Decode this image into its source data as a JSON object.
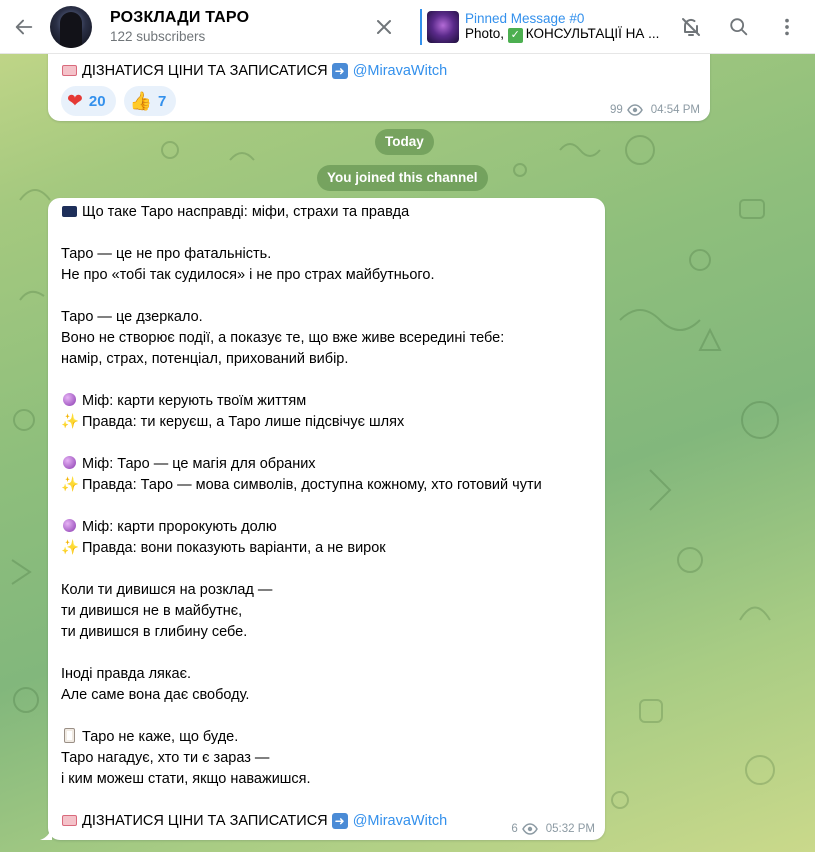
{
  "header": {
    "title": "РОЗКЛАДИ ТАРО",
    "subscribers": "122 subscribers",
    "pinned_title": "Pinned Message #0",
    "pinned_prefix": "Photo, ",
    "pinned_text": "КОНСУЛЬТАЦІЇ НА ..."
  },
  "prev_message": {
    "cta_text": "ДІЗНАТИСЯ ЦІНИ ТА ЗАПИСАТИСЯ",
    "handle": "@MiravaWitch",
    "reactions": [
      {
        "emoji": "heart-icon",
        "count": "20"
      },
      {
        "emoji": "thumbs-up-icon",
        "count": "7"
      }
    ],
    "views": "99",
    "time": "04:54 PM"
  },
  "service": {
    "date_label": "Today",
    "joined_label": "You joined this channel"
  },
  "message": {
    "lines": [
      "Що таке Таро насправді: міфи, страхи та правда",
      "Таро — це не про фатальність.",
      "Не про «тобі так судилося» і не про страх майбутнього.",
      "Таро — це дзеркало.",
      "Воно не створює події, а показує те, що вже живе всередині тебе:",
      "намір, страх, потенціал, прихований вибір.",
      "Міф: карти керують твоїм життям",
      "Правда: ти керуєш, а Таро лише підсвічує шлях",
      "Міф: Таро — це магія для обраних",
      "Правда: Таро — мова символів, доступна кожному, хто готовий чути",
      "Міф: карти пророкують долю",
      "Правда: вони показують варіанти, а не вирок",
      "Коли ти дивишся на розклад —",
      "ти дивишся не в майбутнє,",
      "ти дивишся в глибину себе.",
      "Іноді правда лякає.",
      "Але саме вона дає свободу.",
      "Таро не каже, що буде.",
      "Таро нагадує, хто ти є зараз —",
      "і ким можеш стати, якщо наважишся.",
      "ДІЗНАТИСЯ ЦІНИ ТА ЗАПИСАТИСЯ"
    ],
    "handle": "@MiravaWitch",
    "views": "6",
    "time": "05:32 PM"
  },
  "colors": {
    "accent": "#3390ec",
    "bubble": "#ffffff",
    "meta": "#8c9aa3"
  }
}
